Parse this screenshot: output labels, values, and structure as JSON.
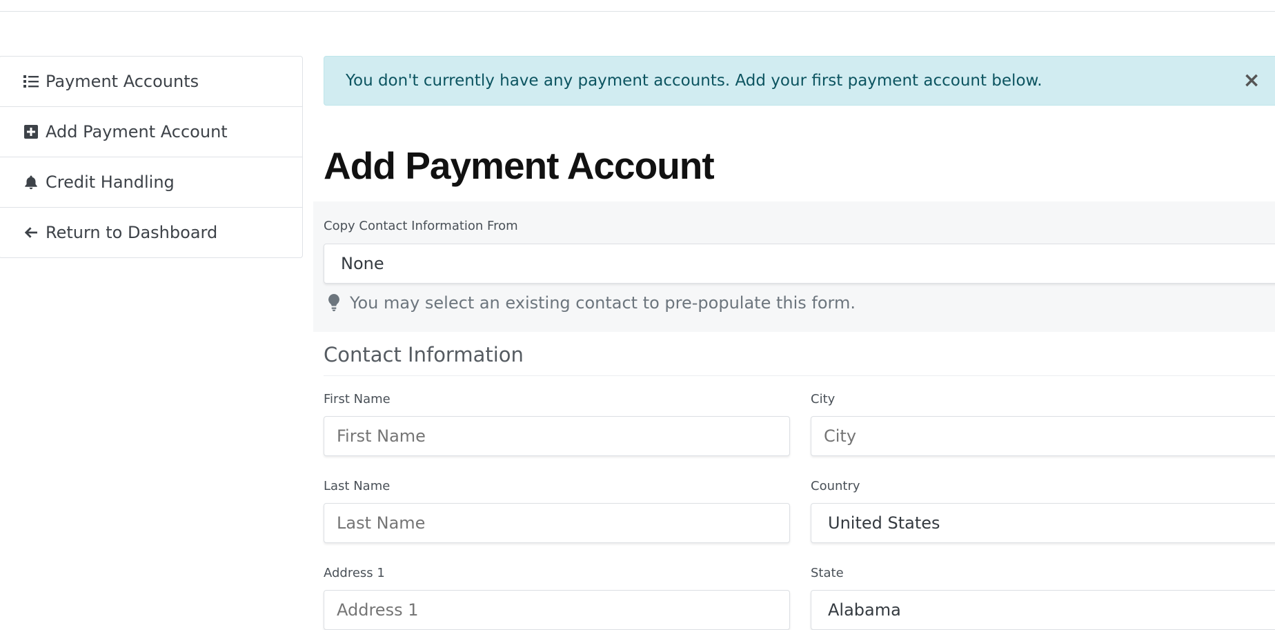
{
  "sidebar": {
    "items": [
      {
        "label": "Payment Accounts",
        "icon": "list-icon"
      },
      {
        "label": "Add Payment Account",
        "icon": "plus-square-icon"
      },
      {
        "label": "Credit Handling",
        "icon": "bell-icon"
      },
      {
        "label": "Return to Dashboard",
        "icon": "arrow-left-icon"
      }
    ]
  },
  "alert": {
    "message": "You don't currently have any payment accounts. Add your first payment account below.",
    "close": "×"
  },
  "page": {
    "title": "Add Payment Account"
  },
  "copy_contact": {
    "label": "Copy Contact Information From",
    "value": "None",
    "help": "You may select an existing contact to pre-populate this form."
  },
  "contact": {
    "section_title": "Contact Information",
    "first_name": {
      "label": "First Name",
      "placeholder": "First Name"
    },
    "last_name": {
      "label": "Last Name",
      "placeholder": "Last Name"
    },
    "address1": {
      "label": "Address 1",
      "placeholder": "Address 1"
    },
    "city": {
      "label": "City",
      "placeholder": "City"
    },
    "country": {
      "label": "Country",
      "value": "United States"
    },
    "state": {
      "label": "State",
      "value": "Alabama"
    }
  },
  "colors": {
    "alert_bg": "#d1ecf1",
    "alert_text": "#0c5460",
    "panel_bg": "#f6f7f8"
  }
}
